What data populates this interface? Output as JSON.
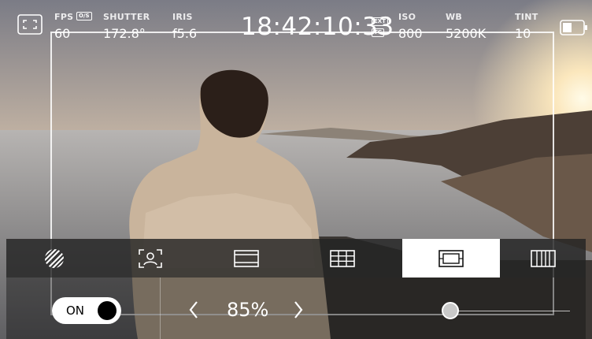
{
  "colors": {
    "accent": "#ffffff",
    "toolbar_bg": "#232323",
    "sky": "#f3d8b0"
  },
  "top": {
    "fps": {
      "label": "FPS",
      "tag": "O/S",
      "value": "60"
    },
    "shutter": {
      "label": "SHUTTER",
      "value": "172.8°"
    },
    "iris": {
      "label": "IRIS",
      "value": "f5.6"
    },
    "timecode": "18:42:10:33",
    "tc_tags": [
      "EXT",
      "TC"
    ],
    "iso": {
      "label": "ISO",
      "value": "800"
    },
    "wb": {
      "label": "WB",
      "value": "5200K"
    },
    "tint": {
      "label": "TINT",
      "value": "10"
    }
  },
  "icons": {
    "fullscreen": "fullscreen-icon",
    "battery": "battery-icon",
    "toolbar": [
      "zebra-icon",
      "focus-assist-icon",
      "frame-guide-icon",
      "grid-icon",
      "safe-area-icon",
      "false-color-icon"
    ]
  },
  "toolbar": {
    "active_index": 4
  },
  "settings": {
    "toggle_label": "ON",
    "toggle_on": true,
    "zoom_value": "85%",
    "zoom_fraction": 0.85
  }
}
